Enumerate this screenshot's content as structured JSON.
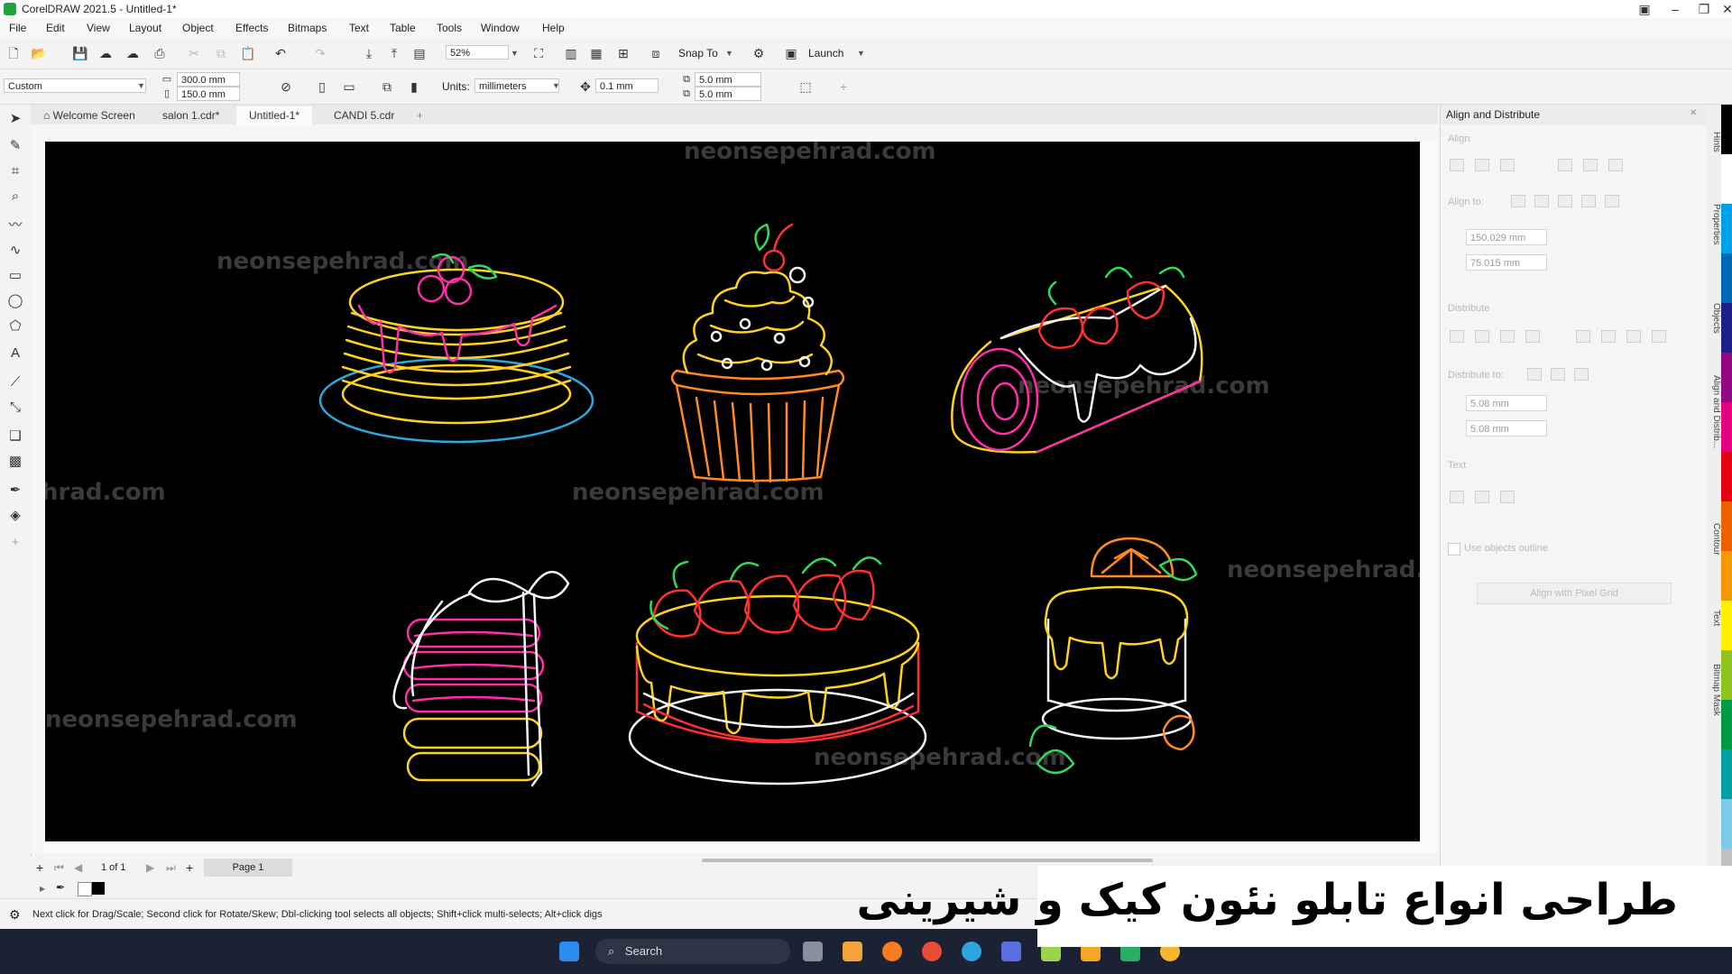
{
  "window": {
    "title": "CorelDRAW 2021.5 - Untitled-1*"
  },
  "menu": [
    "File",
    "Edit",
    "View",
    "Layout",
    "Object",
    "Effects",
    "Bitmaps",
    "Text",
    "Table",
    "Tools",
    "Window",
    "Help"
  ],
  "toolbar": {
    "zoom": "52%",
    "snap_label": "Snap To",
    "launch_label": "Launch"
  },
  "propbar": {
    "preset": "Custom",
    "width": "300.0 mm",
    "height": "150.0 mm",
    "units_label": "Units:",
    "units": "millimeters",
    "nudge": "0.1 mm",
    "dup_x": "5.0 mm",
    "dup_y": "5.0 mm"
  },
  "tabs": [
    {
      "label": "Welcome Screen",
      "active": false
    },
    {
      "label": "salon 1.cdr*",
      "active": false
    },
    {
      "label": "Untitled-1*",
      "active": true
    },
    {
      "label": "CANDI 5.cdr",
      "active": false
    }
  ],
  "watermark": "neonsepehrad.com",
  "watermark_partial": "hrad.com",
  "watermark_partial2": "neonsepehrad.c",
  "docker": {
    "title": "Align and Distribute",
    "align_label": "Align",
    "align_to_label": "Align to:",
    "x": "150.029 mm",
    "y": "75.015 mm",
    "distribute_label": "Distribute",
    "distribute_to_label": "Distribute to:",
    "h": "5.08 mm",
    "v": "5.08 mm",
    "text_label": "Text",
    "use_outline": "Use objects outline",
    "pixel_grid": "Align with Pixel Grid"
  },
  "vtabs": [
    "Hints",
    "Properties",
    "Objects",
    "Align and Distrib...",
    "Contour",
    "Text",
    "Bitmap Mask"
  ],
  "pagenav": {
    "count": "1 of 1",
    "page": "Page 1"
  },
  "status": {
    "hint": "Next click for Drag/Scale; Second click for Rotate/Skew; Dbl-clicking tool selects all objects; Shift+click multi-selects; Alt+click digs"
  },
  "taskbar": {
    "search": "Search"
  },
  "overlay": {
    "text": "طراحی انواع تابلو نئون کیک و شیرینی"
  },
  "colors": {
    "neon_yellow": "#ffd21f",
    "neon_pink": "#ff2fa8",
    "neon_blue": "#29a9e0",
    "neon_red": "#ff3030",
    "neon_green": "#2fdc5a",
    "neon_orange": "#ff8a1f",
    "neon_white": "#f4f4f4"
  },
  "palette": [
    "#000000",
    "#ffffff",
    "#00a0e9",
    "#0068b7",
    "#1d2088",
    "#920783",
    "#e4007f",
    "#e60012",
    "#eb6100",
    "#f39800",
    "#fff100",
    "#8fc31f",
    "#009944",
    "#00a0a0",
    "#7dcbe8",
    "#c0c0c0"
  ]
}
